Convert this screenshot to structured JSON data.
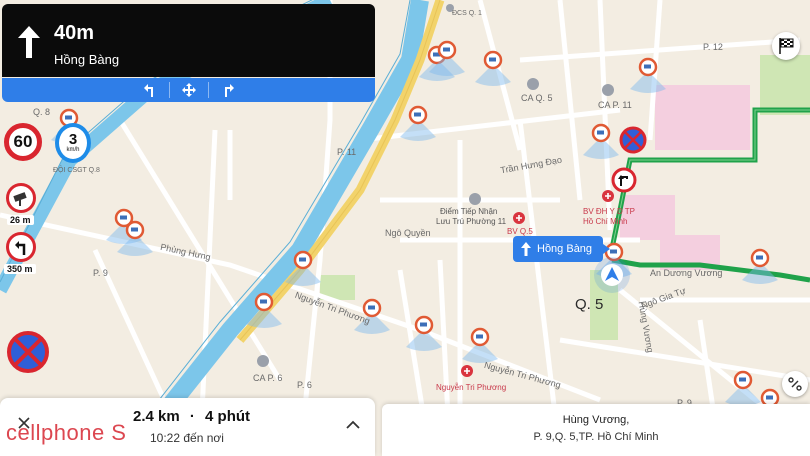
{
  "navigation": {
    "distance": "40m",
    "street": "Hồng Bàng"
  },
  "signs": {
    "speed_limit": "60",
    "current_speed": "3",
    "current_speed_unit": "km/h",
    "sign1_distance": "26 m",
    "sign2_distance": "350 m"
  },
  "callout": {
    "label": "Hồng Bàng"
  },
  "map_labels": {
    "district_q8": "Q. 8",
    "district_q5": "Q. 5",
    "p12": "P. 12",
    "p11": "P. 11",
    "p9a": "P. 9",
    "p9b": "P. 9",
    "p6": "P. 6",
    "ca_q5": "CA Q. 5",
    "ca_p11": "CA P. 11",
    "ca_p6": "CA P. 6",
    "bv_q5": "BV Q.5",
    "csgt_q8": "ĐỘI CSGT Q.8",
    "dcsq": "ĐCS Q. 1",
    "diem_tiep_nhan": "Điểm Tiếp Nhận",
    "luu_tru": "Lưu Trú Phường 11",
    "bv_dhyd": "BV ĐH Y D TP",
    "ho_chi_minh": "Hồ Chí Minh",
    "nguyen_tri_phuong_poi": "Nguyễn Tri Phương",
    "nguyen_tri_phuong_road": "Nguyễn Tri Phương",
    "nguyen_tri_phuong_road2": "Nguyễn Tri Phương",
    "phung_hung": "Phùng Hưng",
    "hung_vuong": "Hùng Vương",
    "an_duong_vuong": "An Dương Vương",
    "ngo_gia_tu": "Ngô Gia Tự",
    "ngo_quyen": "Ngô Quyền",
    "tran_hung_dao": "Trần Hưng Đạo"
  },
  "trip": {
    "distance": "2.4 km",
    "duration": "4 phút",
    "eta": "10:22 đến nơi"
  },
  "destination": {
    "name": "Hùng Vương,",
    "address": "P. 9,Q. 5,TP. Hồ Chí Minh"
  },
  "watermark": "cellphone S",
  "colors": {
    "route": "#1fa24a",
    "primary": "#2f7ee8",
    "canal": "#7cc6ea",
    "major_road": "#f2d36b",
    "camera": "#e05a34"
  },
  "icons": {
    "nav": "straight-arrow-icon",
    "camera": "speed-camera-icon",
    "finish": "checkered-flag-icon",
    "recenter": "compass-icon",
    "no_parking": "no-parking-icon"
  }
}
